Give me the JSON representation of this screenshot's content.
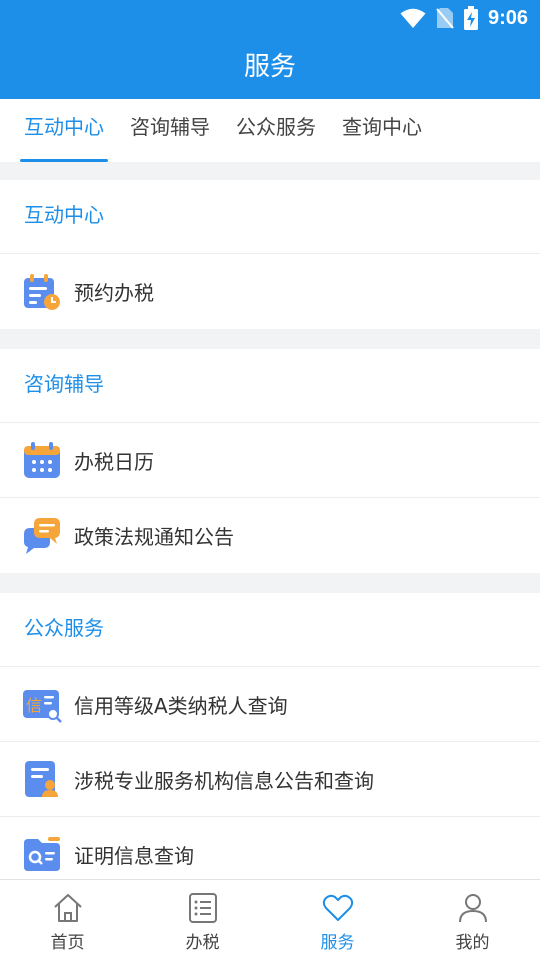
{
  "status_bar": {
    "time": "9:06",
    "icons": [
      "wifi-icon",
      "no-sim-icon",
      "battery-charging-icon"
    ]
  },
  "header": {
    "title": "服务"
  },
  "tabs": [
    {
      "label": "互动中心",
      "active": true
    },
    {
      "label": "咨询辅导",
      "active": false
    },
    {
      "label": "公众服务",
      "active": false
    },
    {
      "label": "查询中心",
      "active": false
    }
  ],
  "sections": [
    {
      "title": "互动中心",
      "items": [
        {
          "label": "预约办税",
          "icon": "appointment-calendar-icon"
        }
      ]
    },
    {
      "title": "咨询辅导",
      "items": [
        {
          "label": "办税日历",
          "icon": "tax-calendar-icon"
        },
        {
          "label": "政策法规通知公告",
          "icon": "chat-bubble-icon"
        }
      ]
    },
    {
      "title": "公众服务",
      "items": [
        {
          "label": "信用等级A类纳税人查询",
          "icon": "credit-search-icon"
        },
        {
          "label": "涉税专业服务机构信息公告和查询",
          "icon": "agency-document-icon"
        },
        {
          "label": "证明信息查询",
          "icon": "certificate-search-icon"
        }
      ]
    }
  ],
  "icon_glyphs": {
    "credit": "信"
  },
  "bottom_nav": [
    {
      "label": "首页",
      "icon": "home-icon",
      "active": false
    },
    {
      "label": "办税",
      "icon": "list-icon",
      "active": false
    },
    {
      "label": "服务",
      "icon": "heart-icon",
      "active": true
    },
    {
      "label": "我的",
      "icon": "user-icon",
      "active": false
    }
  ],
  "colors": {
    "primary": "#1e8fe9",
    "background": "#f2f3f5",
    "icon_orange": "#f6a53b",
    "icon_blue": "#5b8def"
  }
}
